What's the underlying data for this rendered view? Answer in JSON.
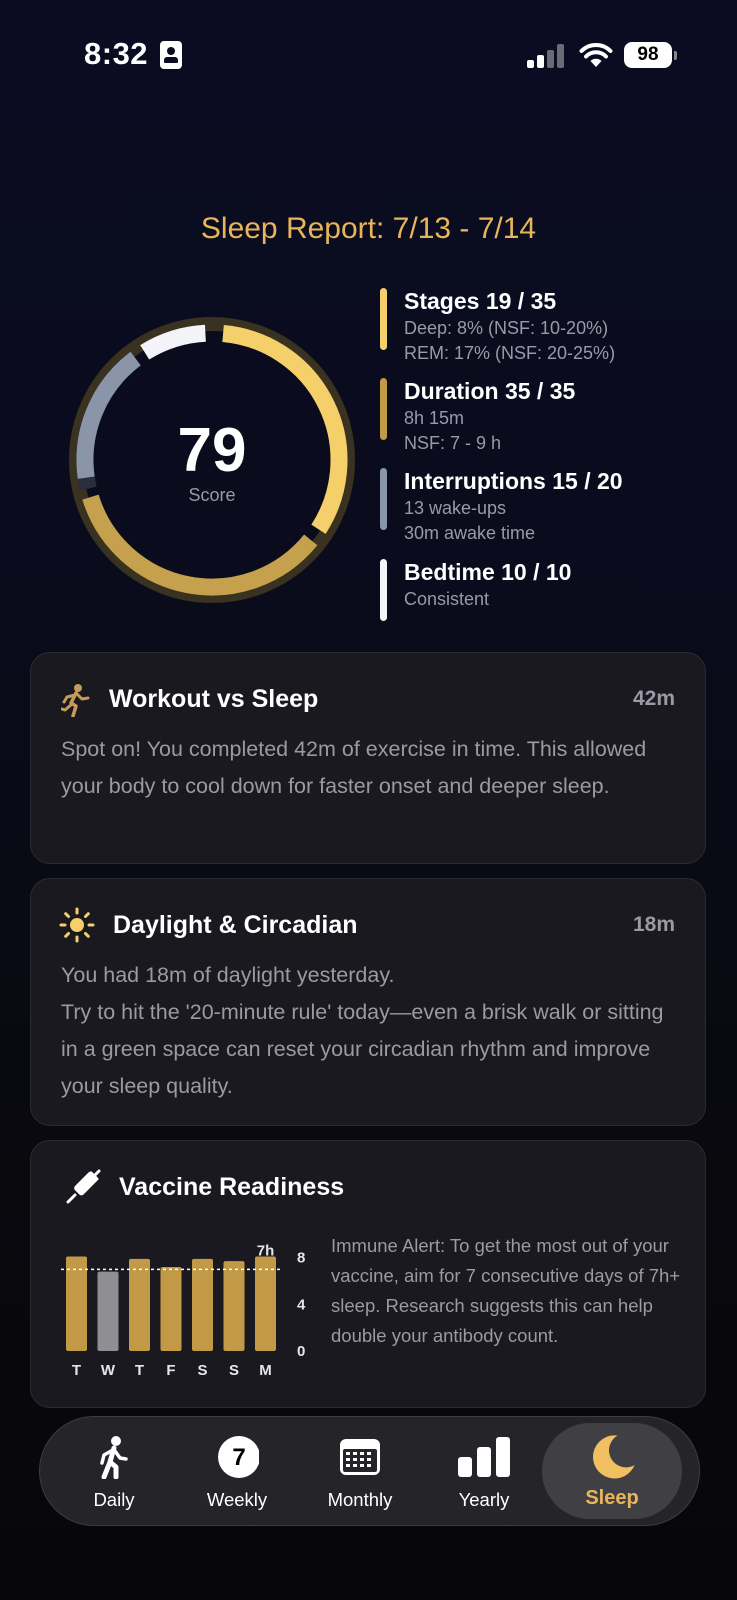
{
  "status_bar": {
    "time": "8:32",
    "battery": "98"
  },
  "report": {
    "title": "Sleep Report: 7/13 - 7/14"
  },
  "score": {
    "value": "79",
    "label": "Score"
  },
  "metrics": [
    {
      "title": "Stages 19 / 35",
      "lines": [
        "Deep: 8% (NSF: 10-20%)",
        "REM: 17% (NSF: 20-25%)"
      ],
      "color": "#f5cf6a"
    },
    {
      "title": "Duration 35 / 35",
      "lines": [
        "8h 15m",
        "NSF: 7 - 9 h"
      ],
      "color": "#c29a47"
    },
    {
      "title": "Interruptions 15 / 20",
      "lines": [
        "13 wake-ups",
        "30m awake time"
      ],
      "color": "#8a95aa"
    },
    {
      "title": "Bedtime 10 / 10",
      "lines": [
        "Consistent"
      ],
      "color": "#f4f4f8"
    }
  ],
  "workout": {
    "title": "Workout vs Sleep",
    "value": "42m",
    "body": "Spot on! You completed 42m of exercise in time. This allowed your body to cool down for faster onset and deeper sleep.",
    "icon": "running-icon"
  },
  "daylight": {
    "title": "Daylight & Circadian",
    "value": "18m",
    "body_line1": "You had 18m of daylight yesterday.",
    "body_line2": "Try to hit the '20-minute rule' today—even a brisk walk or sitting in a green space can reset your circadian rhythm and improve your sleep quality.",
    "icon": "sun-icon"
  },
  "vaccine": {
    "title": "Vaccine Readiness",
    "icon": "syringe-icon",
    "text": "Immune Alert: To get the most out of your vaccine, aim for 7 consecutive days of 7h+ sleep. Research suggests this can help double your antibody count.",
    "threshold_label": "7h",
    "gold": "#c29a47",
    "gray": "#8e8e93"
  },
  "chart_data": {
    "type": "bar",
    "categories": [
      "T",
      "W",
      "T",
      "F",
      "S",
      "S",
      "M"
    ],
    "values": [
      8.1,
      6.8,
      7.9,
      7.2,
      7.9,
      7.7,
      8.1
    ],
    "colors": [
      "gold",
      "gray",
      "gold",
      "gold",
      "gold",
      "gold",
      "gold"
    ],
    "threshold": 7,
    "yticks": [
      "8",
      "4",
      "0"
    ],
    "ylim": [
      0,
      8.4
    ]
  },
  "tabs": [
    {
      "label": "Daily",
      "icon": "walking-icon"
    },
    {
      "label": "Weekly",
      "icon": "calendar-day-icon",
      "badge": "7"
    },
    {
      "label": "Monthly",
      "icon": "calendar-grid-icon"
    },
    {
      "label": "Yearly",
      "icon": "bar-chart-icon"
    },
    {
      "label": "Sleep",
      "icon": "moon-icon",
      "active": true
    }
  ]
}
